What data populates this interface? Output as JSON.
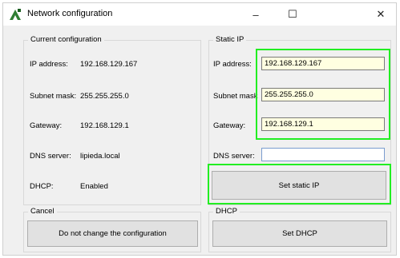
{
  "window": {
    "title": "Network configuration",
    "controls": {
      "minimize": "–",
      "maximize": "☐",
      "close": "✕"
    }
  },
  "current": {
    "group_label": "Current configuration",
    "ip_label": "IP address:",
    "ip_value": "192.168.129.167",
    "subnet_label": "Subnet mask:",
    "subnet_value": "255.255.255.0",
    "gateway_label": "Gateway:",
    "gateway_value": "192.168.129.1",
    "dns_label": "DNS server:",
    "dns_value": "lipieda.local",
    "dhcp_label": "DHCP:",
    "dhcp_value": "Enabled"
  },
  "static_ip": {
    "group_label": "Static IP",
    "ip_label": "IP address:",
    "ip_value": "192.168.129.167",
    "subnet_label": "Subnet mask",
    "subnet_value": "255.255.255.0",
    "gateway_label": "Gateway:",
    "gateway_value": "192.168.129.1",
    "dns_label": "DNS server:",
    "dns_value": "",
    "set_button": "Set static IP"
  },
  "cancel": {
    "group_label": "Cancel",
    "button": "Do not change the configuration"
  },
  "dhcp": {
    "group_label": "DHCP",
    "button": "Set DHCP"
  },
  "colors": {
    "highlight": "#22ee22",
    "input_yellow": "#ffffe1",
    "accent_icon": "#2e7d32"
  }
}
